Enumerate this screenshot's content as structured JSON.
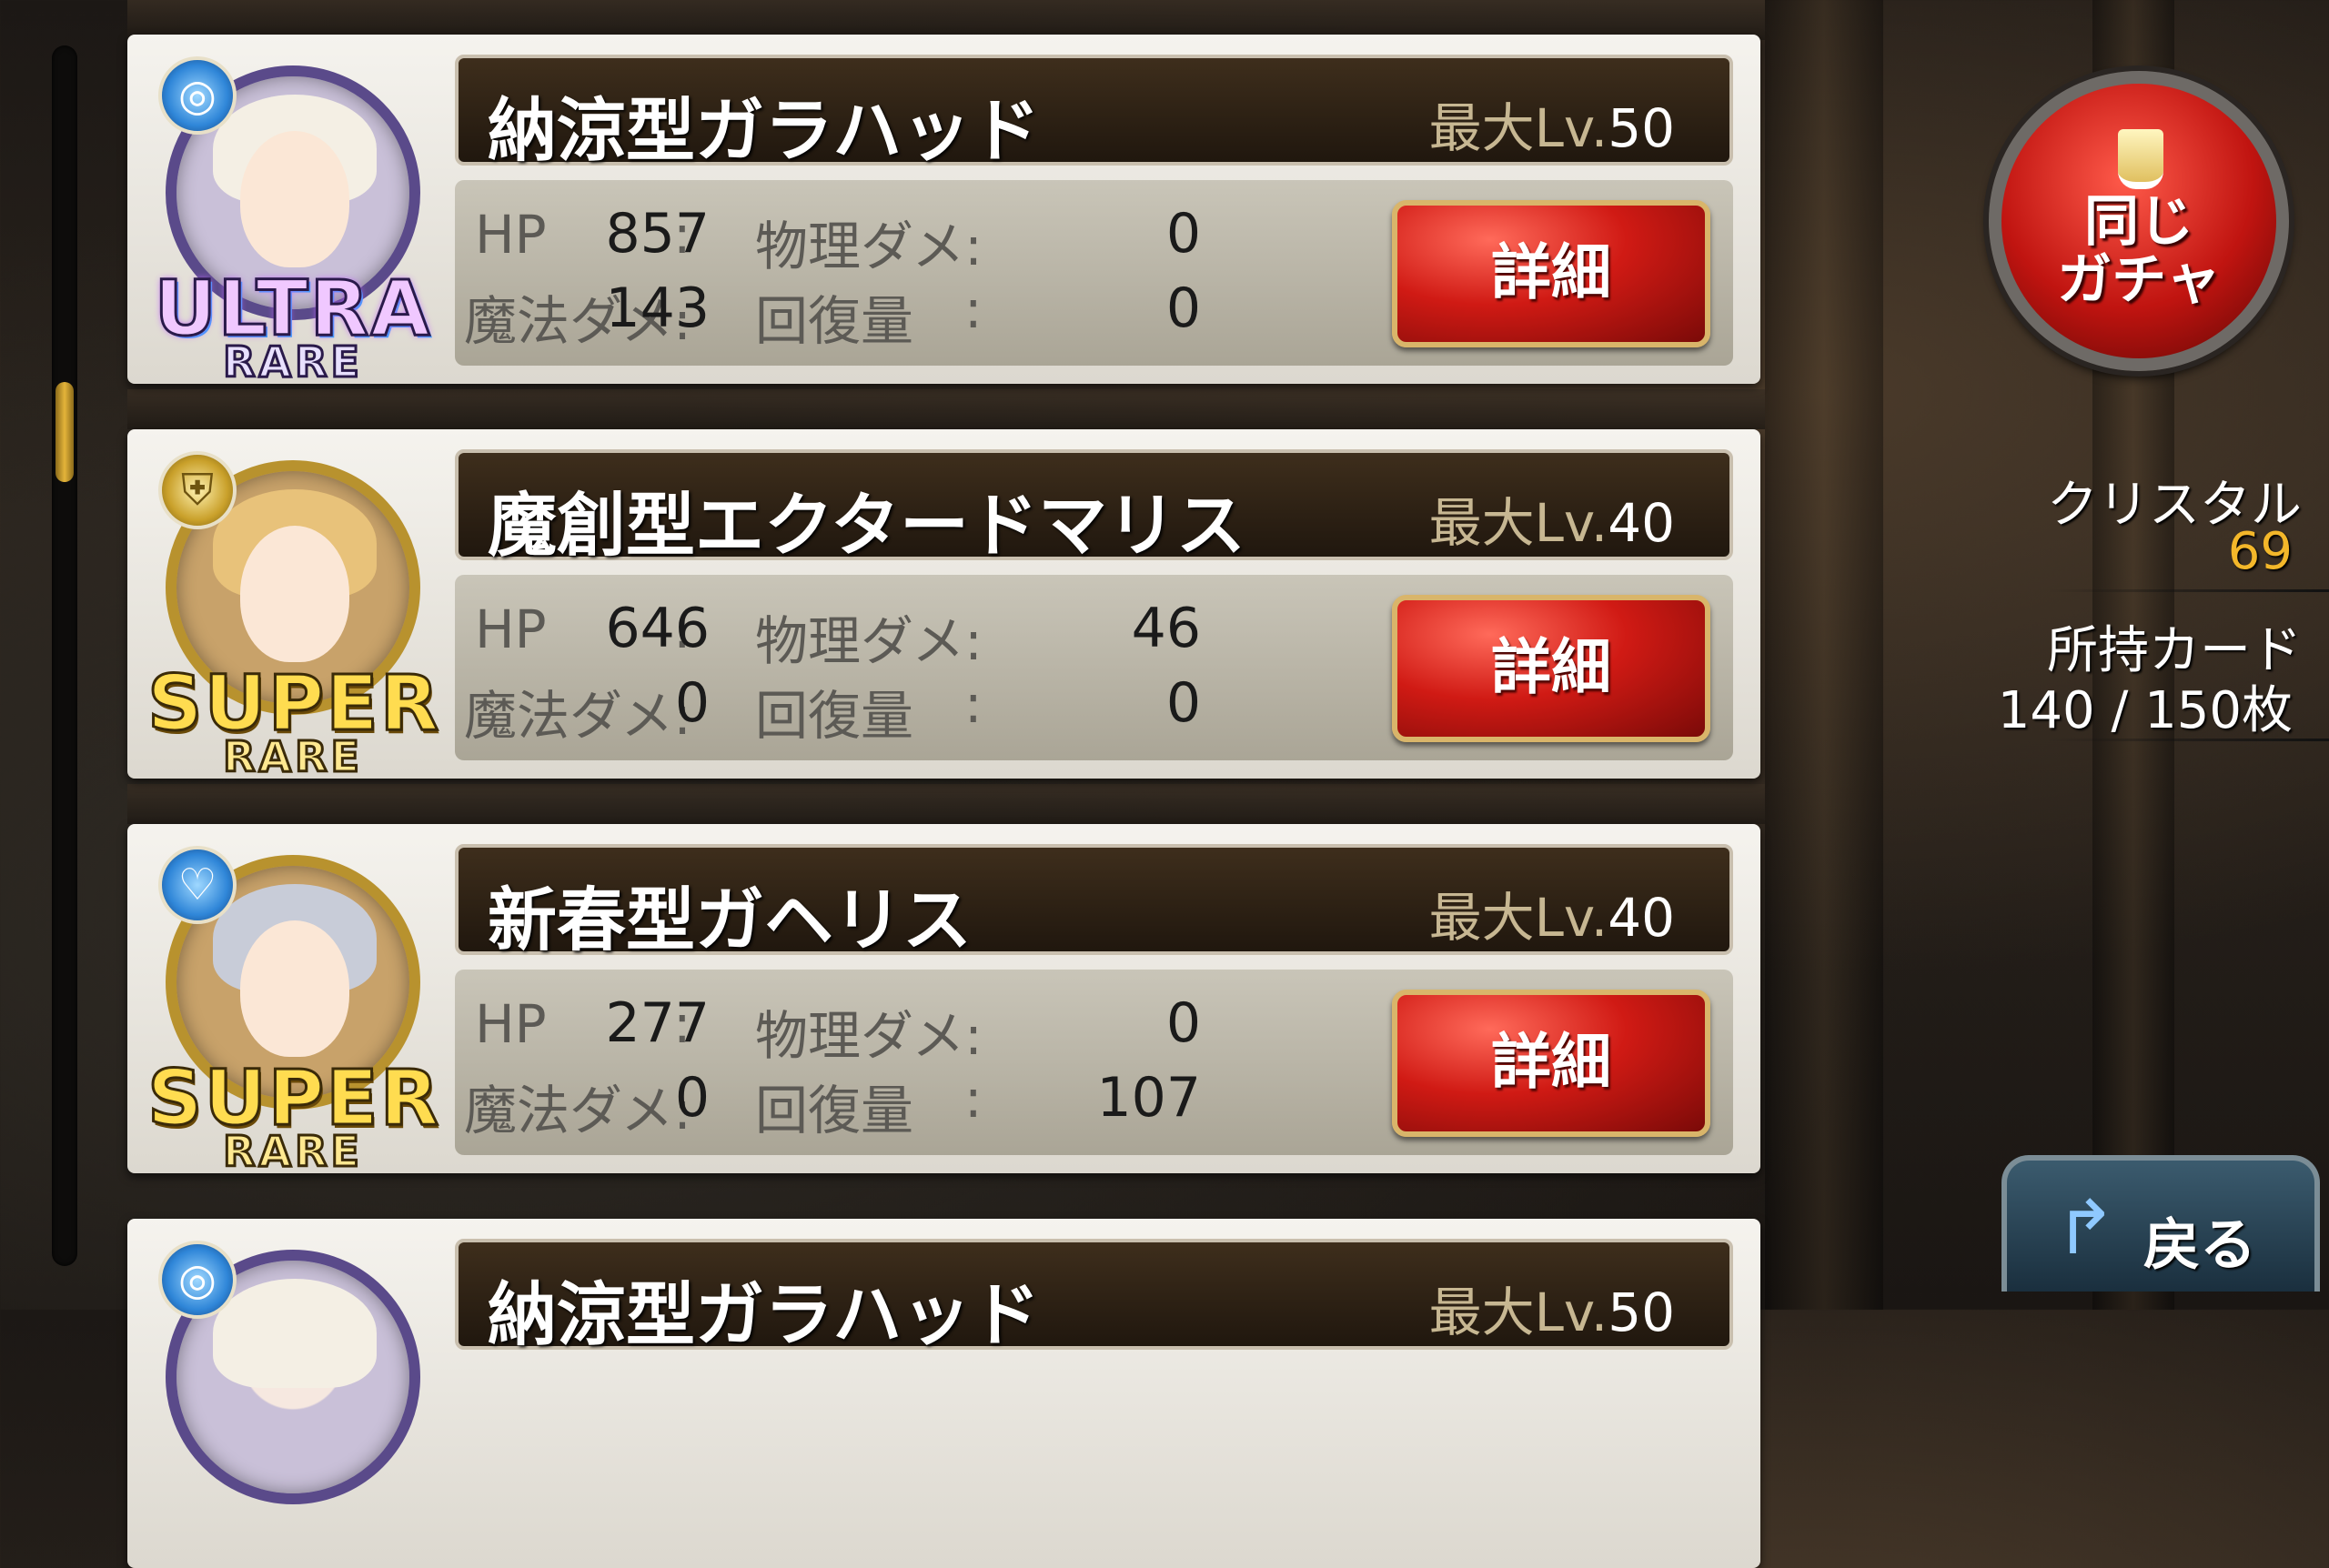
{
  "cards": [
    {
      "name": "納涼型ガラハッド",
      "max_lv_label": "最大Lv.",
      "max_lv": "50",
      "rarity_main": "ULTRA",
      "rarity_sub": "RARE",
      "element_icon": "swirl-icon",
      "hp_label": "HP",
      "hp": "857",
      "phys_label": "物理ダメ:",
      "phys": "0",
      "magic_label": "魔法ダメ:",
      "magic": "143",
      "heal_label": "回復量",
      "heal": "0",
      "detail_label": "詳細"
    },
    {
      "name": "魔創型エクタードマリス",
      "max_lv_label": "最大Lv.",
      "max_lv": "40",
      "rarity_main": "SUPER",
      "rarity_sub": "RARE",
      "element_icon": "shield-icon",
      "hp_label": "HP",
      "hp": "646",
      "phys_label": "物理ダメ:",
      "phys": "46",
      "magic_label": "魔法ダメ:",
      "magic": "0",
      "heal_label": "回復量",
      "heal": "0",
      "detail_label": "詳細"
    },
    {
      "name": "新春型ガヘリス",
      "max_lv_label": "最大Lv.",
      "max_lv": "40",
      "rarity_main": "SUPER",
      "rarity_sub": "RARE",
      "element_icon": "heart-icon",
      "hp_label": "HP",
      "hp": "277",
      "phys_label": "物理ダメ:",
      "phys": "0",
      "magic_label": "魔法ダメ:",
      "magic": "0",
      "heal_label": "回復量",
      "heal": "107",
      "detail_label": "詳細"
    },
    {
      "name": "納涼型ガラハッド",
      "max_lv_label": "最大Lv.",
      "max_lv": "50",
      "element_icon": "swirl-icon"
    }
  ],
  "colon": ":",
  "side": {
    "gacha_button": "同じ\nガチャ",
    "crystal_label": "クリスタル",
    "crystal_value": "69",
    "cards_label": "所持カード",
    "cards_value": "140 / 150枚",
    "back_label": "戻る"
  },
  "colors": {
    "detail_button": "#d01a14",
    "crystal_value": "#f3b72a",
    "name_bar": "#2a1f14"
  }
}
